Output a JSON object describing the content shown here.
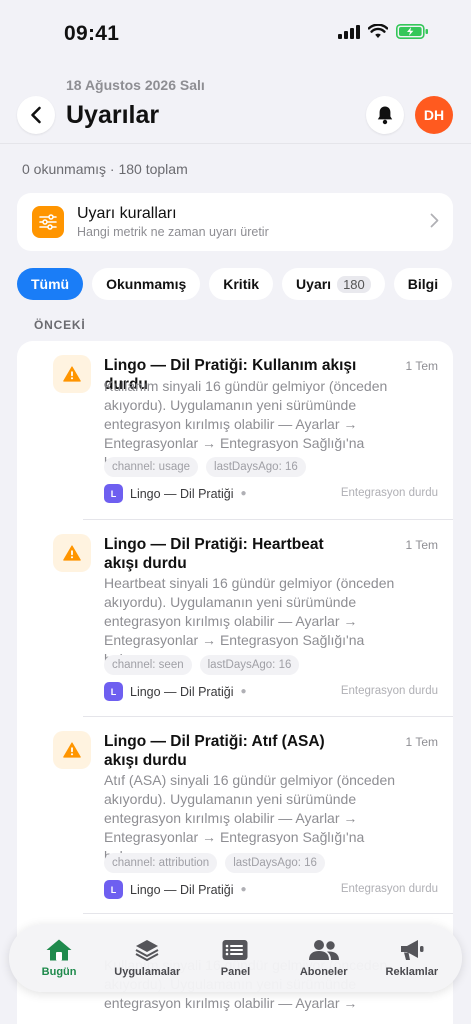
{
  "status_bar": {
    "time": "09:41"
  },
  "header": {
    "date": "18 Ağustos 2026 Salı",
    "title": "Uyarılar",
    "avatar_initials": "DH"
  },
  "summary": {
    "counts": "0 okunmamış · 180 toplam"
  },
  "rules_card": {
    "title": "Uyarı kuralları",
    "subtitle": "Hangi metrik ne zaman uyarı üretir"
  },
  "filters": [
    {
      "label": "Tümü",
      "active": true
    },
    {
      "label": "Okunmamış"
    },
    {
      "label": "Kritik"
    },
    {
      "label": "Uyarı",
      "count": "180"
    },
    {
      "label": "Bilgi"
    }
  ],
  "section_label": "ÖNCEKİ",
  "alerts": [
    {
      "title": "Lingo — Dil Pratiği: Kullanım akışı durdu",
      "time": "1 Tem",
      "body": "Kullanım sinyali 16 gündür gelmiyor (önceden akıyordu). Uygulamanın yeni sürümünde entegrasyon kırılmış olabilir — Ayarlar → Entegrasyonlar → Entegrasyon Sağlığı'na bakın.",
      "tags": [
        "channel: usage",
        "lastDaysAgo: 16"
      ],
      "app_initial": "L",
      "app_name": "Lingo — Dil Pratiği",
      "status": "Entegrasyon durdu"
    },
    {
      "title": "Lingo — Dil Pratiği: Heartbeat akışı durdu",
      "time": "1 Tem",
      "body": "Heartbeat sinyali 16 gündür gelmiyor (önceden akıyordu). Uygulamanın yeni sürümünde entegrasyon kırılmış olabilir — Ayarlar → Entegrasyonlar → Entegrasyon Sağlığı'na bakın.",
      "tags": [
        "channel: seen",
        "lastDaysAgo: 16"
      ],
      "app_initial": "L",
      "app_name": "Lingo — Dil Pratiği",
      "status": "Entegrasyon durdu"
    },
    {
      "title": "Lingo — Dil Pratiği: Atıf (ASA) akışı durdu",
      "time": "1 Tem",
      "body": "Atıf (ASA) sinyali 16 gündür gelmiyor (önceden akıyordu). Uygulamanın yeni sürümünde entegrasyon kırılmış olabilir — Ayarlar → Entegrasyonlar → Entegrasyon Sağlığı'na bakın.",
      "tags": [
        "channel: attribution",
        "lastDaysAgo: 16"
      ],
      "app_initial": "L",
      "app_name": "Lingo — Dil Pratiği",
      "status": "Entegrasyon durdu"
    },
    {
      "body_partial": "Kullanım sinyali 16 gündür gelmiyor (önceden akıyordu). Uygulamanın yeni sürümünde entegrasyon kırılmış olabilir — Ayarlar →"
    }
  ],
  "tabbar": [
    {
      "label": "Bugün",
      "icon": "home-icon",
      "active": true
    },
    {
      "label": "Uygulamalar",
      "icon": "layers-icon"
    },
    {
      "label": "Panel",
      "icon": "panel-icon"
    },
    {
      "label": "Aboneler",
      "icon": "people-icon"
    },
    {
      "label": "Reklamlar",
      "icon": "megaphone-icon"
    }
  ],
  "colors": {
    "accent": "#1a7df7",
    "avatar": "#ff5a1f",
    "warning": "#ff9500",
    "active_tab": "#1f8a4c",
    "app_badge": "#6e5ff0"
  }
}
